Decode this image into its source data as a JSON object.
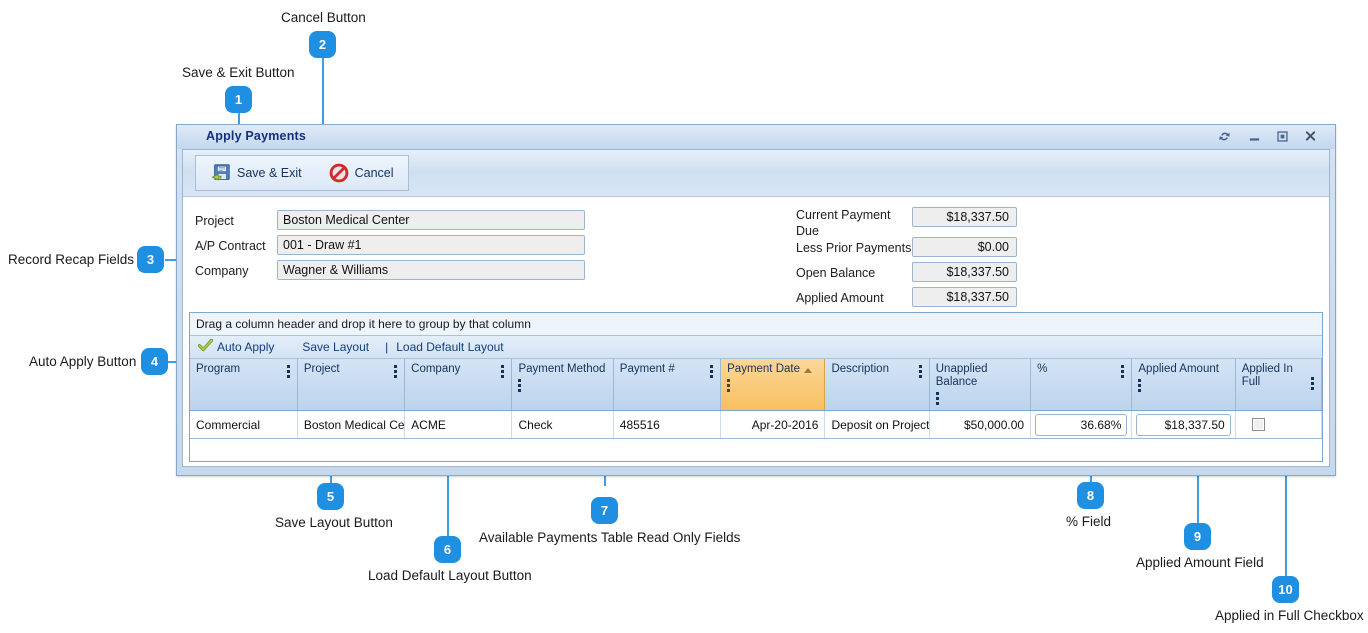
{
  "window": {
    "title": "Apply Payments",
    "controls": {
      "refresh": "refresh-icon",
      "minimize": "minimize-icon",
      "maximize": "maximize-icon",
      "close": "X"
    }
  },
  "toolbar": {
    "save_exit_label": "Save & Exit",
    "cancel_label": "Cancel"
  },
  "form": {
    "left": [
      {
        "label": "Project",
        "value": "Boston Medical Center"
      },
      {
        "label": "A/P Contract",
        "value": "001 - Draw #1"
      },
      {
        "label": "Company",
        "value": "Wagner & Williams"
      }
    ],
    "right": [
      {
        "label": "Current Payment Due",
        "value": "$18,337.50"
      },
      {
        "label": "Less Prior Payments",
        "value": "$0.00"
      },
      {
        "label": "Open Balance",
        "value": "$18,337.50"
      },
      {
        "label": "Applied Amount",
        "value": "$18,337.50"
      }
    ]
  },
  "grid": {
    "group_bar_text": "Drag a column header and drop it here to group by that column",
    "toolbar": {
      "auto_apply": "Auto Apply",
      "save_layout": "Save Layout",
      "separator": "|",
      "load_default_layout": "Load Default Layout"
    },
    "columns": [
      {
        "label": "Program",
        "sorted": false
      },
      {
        "label": "Project",
        "sorted": false
      },
      {
        "label": "Company",
        "sorted": false
      },
      {
        "label": "Payment Method",
        "sorted": false
      },
      {
        "label": "Payment #",
        "sorted": false
      },
      {
        "label": "Payment Date",
        "sorted": true,
        "sort_dir": "asc"
      },
      {
        "label": "Description",
        "sorted": false
      },
      {
        "label": "Unapplied Balance",
        "sorted": false
      },
      {
        "label": "%",
        "sorted": false
      },
      {
        "label": "Applied Amount",
        "sorted": false
      },
      {
        "label": "Applied In Full",
        "sorted": false
      }
    ],
    "rows": [
      {
        "program": "Commercial",
        "project": "Boston Medical Ce",
        "company": "ACME",
        "payment_method": "Check",
        "payment_number": "485516",
        "payment_date": "Apr-20-2016",
        "description": "Deposit on Project",
        "unapplied_balance": "$50,000.00",
        "percent": "36.68%",
        "applied_amount": "$18,337.50",
        "applied_in_full": false
      }
    ]
  },
  "annotations": [
    {
      "number": "1",
      "label": "Save & Exit Button"
    },
    {
      "number": "2",
      "label": "Cancel Button"
    },
    {
      "number": "3",
      "label": "Record Recap Fields"
    },
    {
      "number": "4",
      "label": "Auto Apply Button"
    },
    {
      "number": "5",
      "label": "Save Layout Button"
    },
    {
      "number": "6",
      "label": "Load Default Layout Button"
    },
    {
      "number": "7",
      "label": "Available Payments Table Read Only Fields"
    },
    {
      "number": "8",
      "label": "% Field"
    },
    {
      "number": "9",
      "label": "Applied Amount Field"
    },
    {
      "number": "10",
      "label": "Applied in Full Checkbox"
    }
  ],
  "colors": {
    "accent": "#1e8fe1",
    "leader_line": "#3d9ee6",
    "title_text": "#15317e",
    "sorted_column": "#f9bf5e",
    "grid_header": "#bcd4ec"
  }
}
